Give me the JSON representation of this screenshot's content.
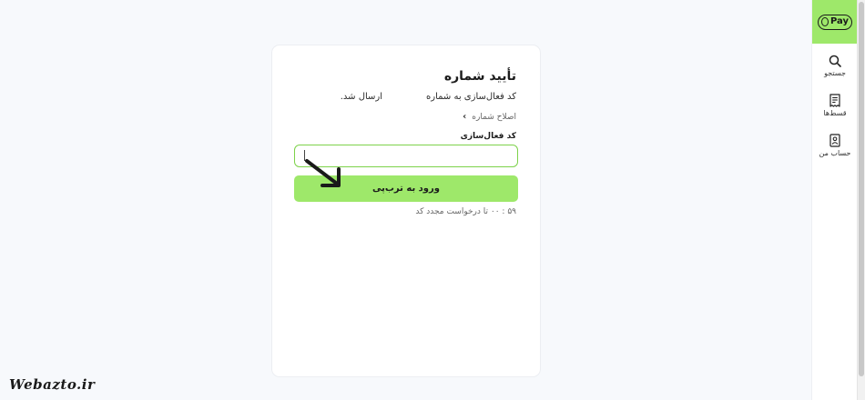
{
  "brand": {
    "logo_text": "Pay",
    "accent": "#9ee86a"
  },
  "sidebar": {
    "items": [
      {
        "label": "جستجو",
        "icon": "search-icon"
      },
      {
        "label": "قسط‌ها",
        "icon": "receipt-icon"
      },
      {
        "label": "حساب من",
        "icon": "account-icon"
      }
    ]
  },
  "verify": {
    "title": "تأیید شماره",
    "sent_prefix": "کد فعال‌سازی به شماره",
    "sent_suffix": "ارسال شد.",
    "edit_link": "اصلاح شماره",
    "field_label": "کد فعال‌سازی",
    "input_value": "",
    "submit_label": "ورود به ترب‌پی",
    "resend_text": "۵۹ : ۰۰  تا درخواست مجدد کد"
  },
  "watermark": "Webazto.ir"
}
